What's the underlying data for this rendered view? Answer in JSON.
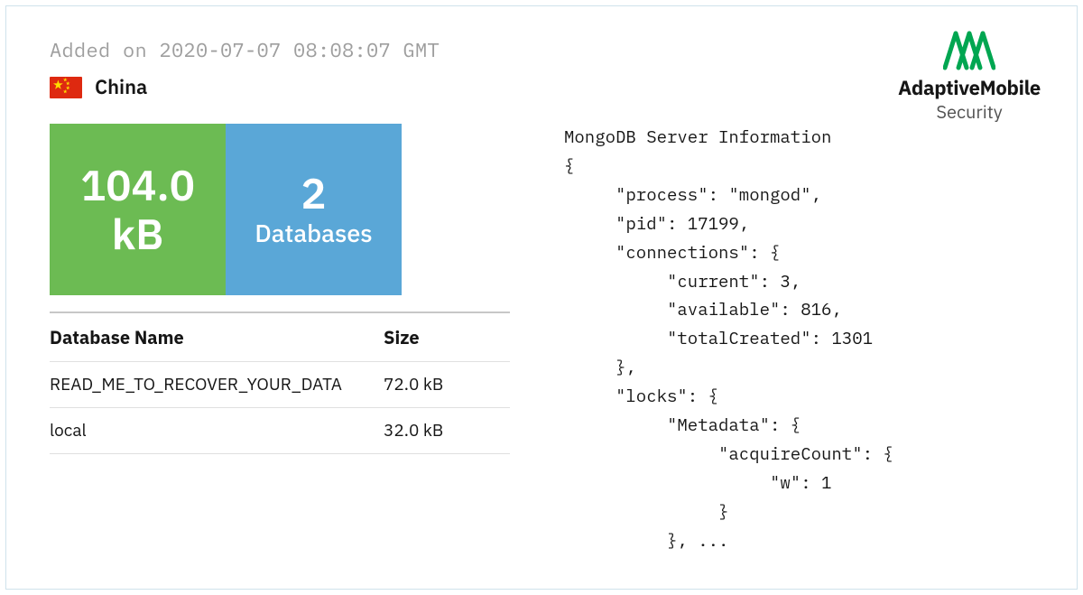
{
  "meta": {
    "added_on": "Added on 2020-07-07 08:08:07 GMT",
    "country": "China"
  },
  "stats": {
    "size_value": "104.0",
    "size_unit": "kB",
    "db_count": "2",
    "db_label": "Databases"
  },
  "table": {
    "headers": {
      "name": "Database Name",
      "size": "Size"
    },
    "rows": [
      {
        "name": "READ_ME_TO_RECOVER_YOUR_DATA",
        "size": "72.0 kB"
      },
      {
        "name": "local",
        "size": "32.0 kB"
      }
    ]
  },
  "server_info": {
    "title": "MongoDB Server Information",
    "body": "{\n     \"process\": \"mongod\",\n     \"pid\": 17199,\n     \"connections\": {\n          \"current\": 3,\n          \"available\": 816,\n          \"totalCreated\": 1301\n     },\n     \"locks\": {\n          \"Metadata\": {\n               \"acquireCount\": {\n                    \"w\": 1\n               }\n          }, ..."
  },
  "brand": {
    "line1": "AdaptiveMobile",
    "line2": "Security"
  }
}
